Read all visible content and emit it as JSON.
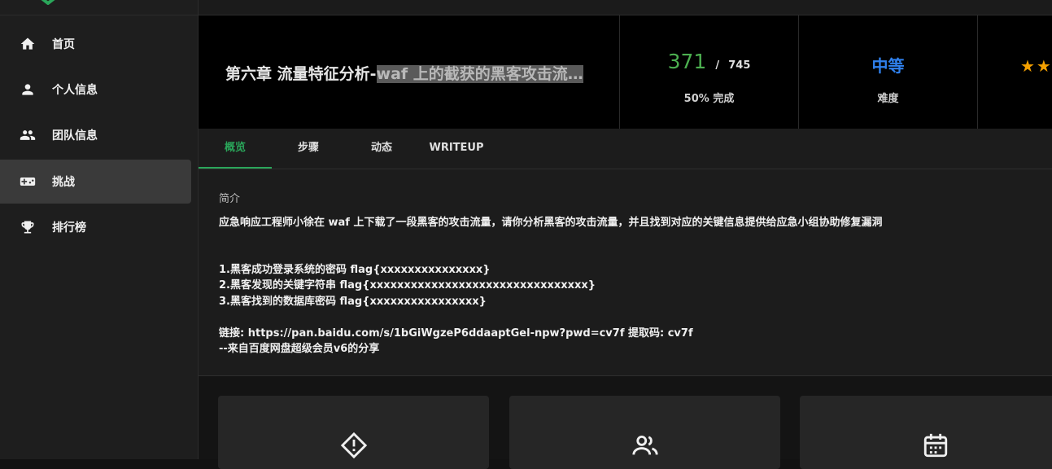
{
  "sidebar": {
    "items": [
      {
        "label": "首页",
        "icon": "home-icon"
      },
      {
        "label": "个人信息",
        "icon": "person-icon"
      },
      {
        "label": "团队信息",
        "icon": "group-icon"
      },
      {
        "label": "挑战",
        "icon": "gamepad-icon",
        "active": true
      },
      {
        "label": "排行榜",
        "icon": "trophy-icon"
      }
    ]
  },
  "header": {
    "title_prefix": "第六章 流量特征分析-",
    "title_highlight": "waf 上的截获的黑客攻击流…",
    "solved": "371",
    "separator": "/",
    "total": "745",
    "completion": "50% 完成",
    "difficulty": "中等",
    "difficulty_label": "难度",
    "stars": "★★"
  },
  "tabs": [
    {
      "label": "概览",
      "active": true
    },
    {
      "label": "步骤"
    },
    {
      "label": "动态"
    },
    {
      "label": "WRITEUP"
    }
  ],
  "overview": {
    "section_title": "简介",
    "description": "应急响应工程师小徐在 waf 上下载了一段黑客的攻击流量，请你分析黑客的攻击流量，并且找到对应的关键信息提供给应急小组协助修复漏洞",
    "items": [
      "1.黑客成功登录系统的密码 flag{xxxxxxxxxxxxxxx}",
      "2.黑客发现的关键字符串 flag{xxxxxxxxxxxxxxxxxxxxxxxxxxxxxxxx}",
      "3.黑客找到的数据库密码 flag{xxxxxxxxxxxxxxxx}"
    ],
    "link": "链接: https://pan.baidu.com/s/1bGiWgzeP6ddaaptGel-npw?pwd=cv7f 提取码: cv7f",
    "source": "--来自百度网盘超级会员v6的分享"
  },
  "cards": [
    {
      "icon": "alert-diamond-icon"
    },
    {
      "icon": "people-icon"
    },
    {
      "icon": "calendar-icon"
    }
  ],
  "colors": {
    "accent": "#2aa65a",
    "solved": "#4caf50",
    "difficulty": "#2f80ed",
    "star": "#f4a000"
  }
}
